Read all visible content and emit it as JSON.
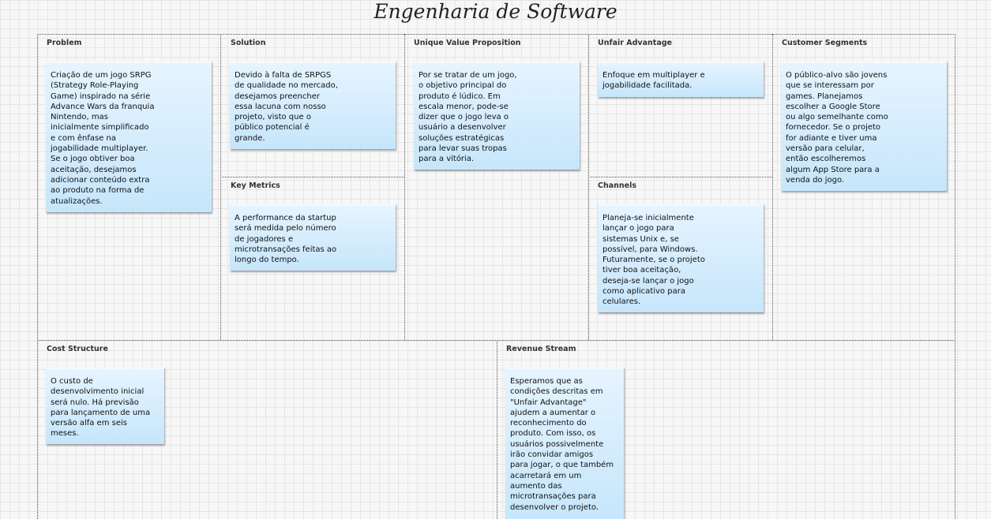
{
  "title": "Engenharia de Software",
  "sections": {
    "problem": {
      "title": "Problem",
      "note": "Criação de um jogo SRPG\n(Strategy Role-Playing\nGame) inspirado na série\nAdvance Wars da franquia\nNintendo, mas\ninicialmente simplificado\ne com ênfase na\njogabilidade multiplayer.\nSe o jogo obtiver boa\naceitação, desejamos\nadicionar conteúdo extra\nao produto na forma de\natualizações."
    },
    "solution": {
      "title": "Solution",
      "note": "Devido à falta de SRPGS\nde qualidade no mercado,\ndesejamos preencher\nessa lacuna com nosso\nprojeto, visto que o\npúblico potencial é\ngrande."
    },
    "key_metrics": {
      "title": "Key Metrics",
      "note": "A performance da startup\nserá medida pelo número\nde jogadores e\nmicrotransações feitas ao\nlongo do tempo."
    },
    "unique_value_proposition": {
      "title": "Unique Value Proposition",
      "note": "Por se tratar de um jogo,\no objetivo principal do\nproduto é lúdico. Em\nescala menor, pode-se\ndizer que o jogo leva o\nusuário a desenvolver\nsoluções estratégicas\npara levar suas tropas\npara a vitória."
    },
    "unfair_advantage": {
      "title": "Unfair Advantage",
      "note": "Enfoque em multiplayer e\njogabilidade facilitada."
    },
    "channels": {
      "title": "Channels",
      "note": "Planeja-se inicialmente\nlançar o jogo para\nsistemas Unix e, se\npossível, para Windows.\nFuturamente, se o projeto\ntiver boa aceitação,\ndeseja-se lançar o jogo\ncomo aplicativo para\ncelulares."
    },
    "customer_segments": {
      "title": "Customer Segments",
      "note": "O público-alvo são jovens\nque se interessam por\ngames. Planejamos\nescolher a Google Store\nou algo semelhante como\nfornecedor. Se o projeto\nfor adiante e tiver uma\nversão para celular,\nentão escolheremos\nalgum App Store para a\nvenda do jogo."
    },
    "cost_structure": {
      "title": "Cost Structure",
      "note": "O custo de\ndesenvolvimento inicial\nserá nulo. Há previsão\npara lançamento de uma\nversão alfa em seis\nmeses."
    },
    "revenue_stream": {
      "title": "Revenue Stream",
      "note": "Esperamos que as\ncondições descritas em\n\"Unfair Advantage\"\najudem a aumentar o\nreconhecimento do\nproduto. Com isso, os\nusuários possivelmente\nirão convidar amigos\npara jogar, o que também\nacarretará em um\naumento das\nmicrotransações para\ndesenvolver o projeto."
    }
  }
}
